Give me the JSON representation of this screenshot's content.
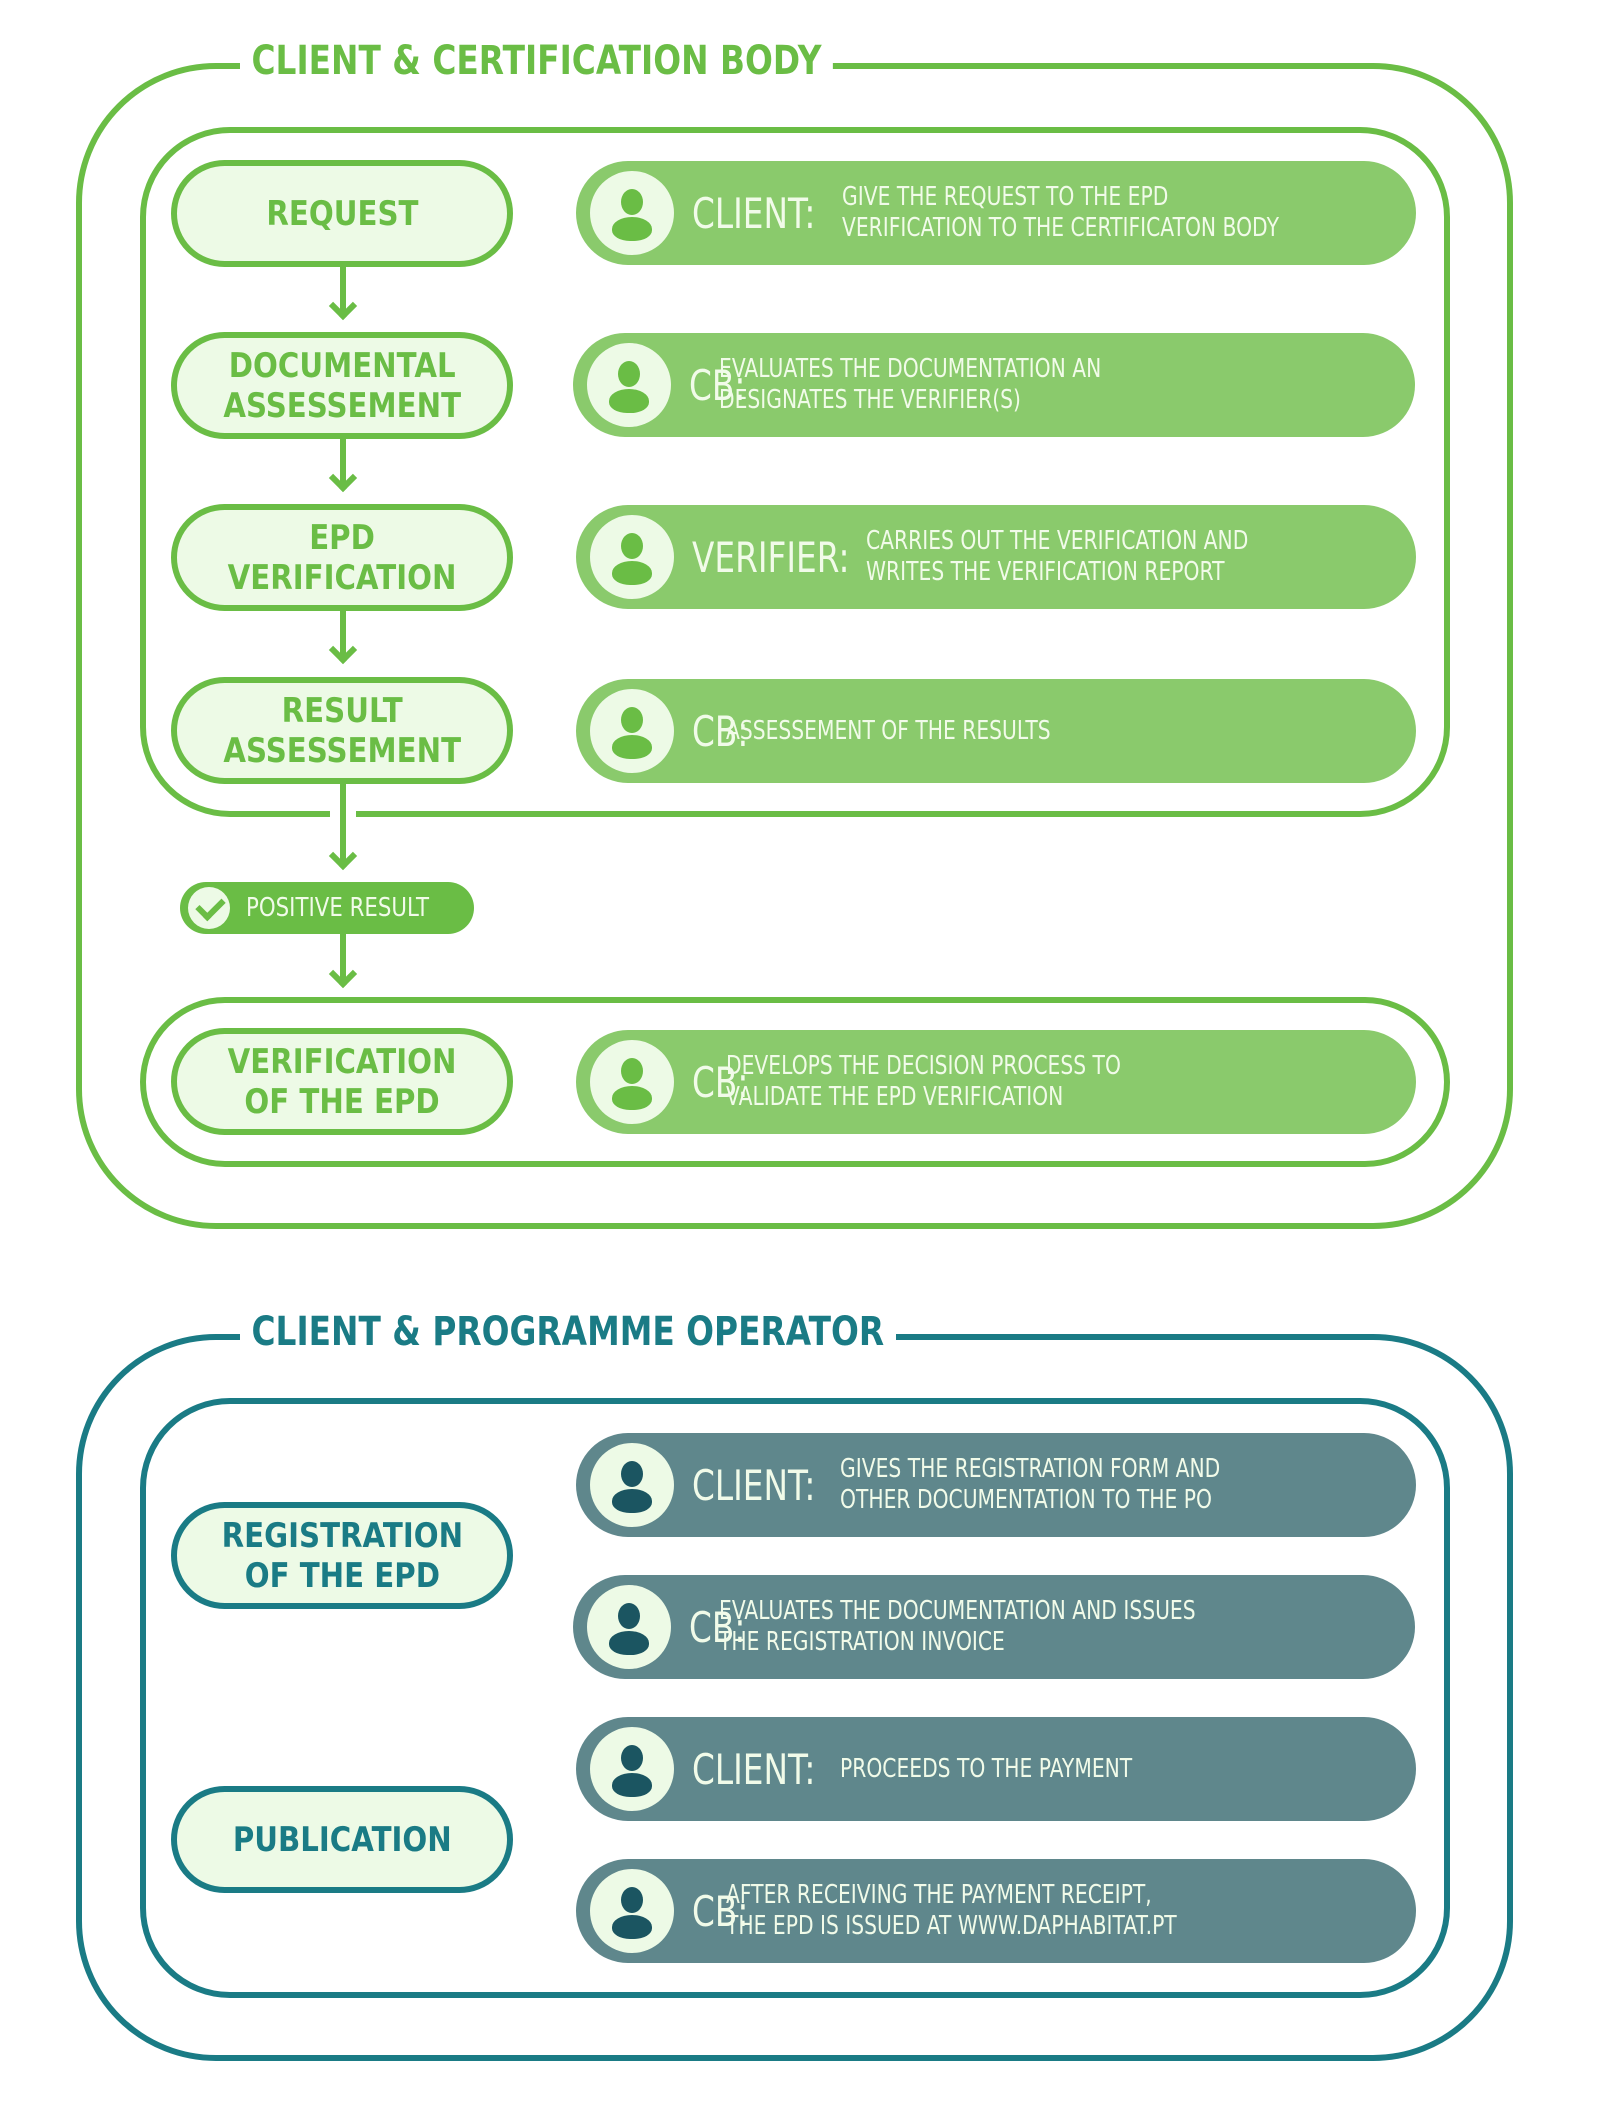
{
  "sections": [
    {
      "title": "CLIENT & CERTIFICATION BODY",
      "color": "#6abd45",
      "stages": [
        {
          "label": "REQUEST",
          "action": {
            "role": "CLIENT:",
            "text": "GIVE THE REQUEST TO THE EPD\nVERIFICATION TO THE CERTIFICATON BODY"
          }
        },
        {
          "label": "DOCUMENTAL\nASSESSEMENT",
          "action": {
            "role": "CB:",
            "text": "EVALUATES THE DOCUMENTATION AN\nDESIGNATES THE VERIFIER(S)"
          }
        },
        {
          "label": "EPD\nVERIFICATION",
          "action": {
            "role": "VERIFIER:",
            "text": "CARRIES OUT THE VERIFICATION AND\nWRITES THE VERIFICATION REPORT"
          }
        },
        {
          "label": "RESULT\nASSESSEMENT",
          "action": {
            "role": "CB:",
            "text": "ASSESSEMENT OF THE RESULTS"
          }
        }
      ],
      "decision": {
        "label": "POSITIVE RESULT",
        "icon": "check-circle-icon"
      },
      "final_stage": {
        "label": "VERIFICATION\nOF THE EPD",
        "action": {
          "role": "CB:",
          "text": "DEVELOPS THE DECISION PROCESS TO\nVALIDATE THE EPD VERIFICATION"
        }
      }
    },
    {
      "title": "CLIENT & PROGRAMME OPERATOR",
      "color": "#1a7b85",
      "stages": [
        {
          "label": "REGISTRATION\nOF THE EPD"
        },
        {
          "label": "PUBLICATION"
        }
      ],
      "actions": [
        {
          "role": "CLIENT:",
          "text": "GIVES THE REGISTRATION FORM AND\nOTHER DOCUMENTATION TO THE PO"
        },
        {
          "role": "CB:",
          "text": "EVALUATES THE DOCUMENTATION AND ISSUES\nTHE REGISTRATION INVOICE"
        },
        {
          "role": "CLIENT:",
          "text": "PROCEEDS TO THE PAYMENT"
        },
        {
          "role": "CB:",
          "text": "AFTER RECEIVING THE PAYMENT RECEIPT,\nTHE EPD IS ISSUED AT WWW.DAPHABITAT.PT"
        }
      ]
    }
  ],
  "icons": {
    "person": "person-icon",
    "check": "check-circle-icon",
    "arrow": "arrow-down-icon"
  }
}
